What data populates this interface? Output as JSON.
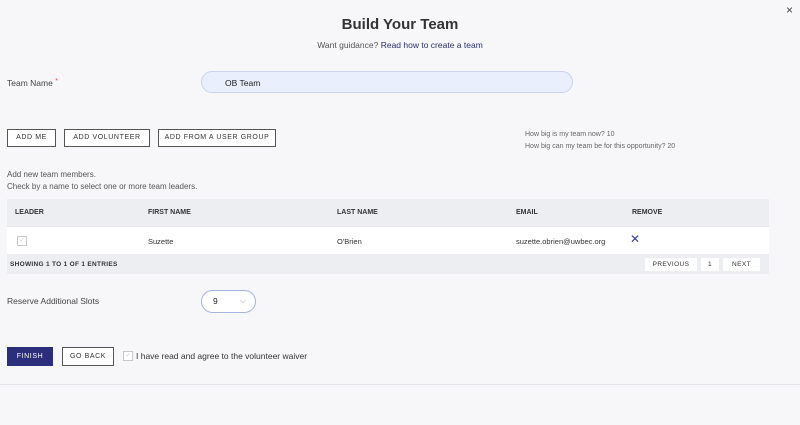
{
  "dialog": {
    "close_glyph": "×",
    "title": "Build Your Team",
    "guidance_prefix": "Want guidance?",
    "guidance_link": "Read how to create a team"
  },
  "team": {
    "label": "Team Name",
    "required_mark": "*",
    "value": "OB Team"
  },
  "actions": {
    "add_me": "ADD ME",
    "add_volunteer": "ADD VOLUNTEER",
    "add_from_group": "ADD FROM A USER GROUP"
  },
  "team_info": {
    "size_now": "How big is my team now? 10",
    "size_max": "How big can my team be for this opportunity? 20"
  },
  "hints": {
    "line1": "Add new team members.",
    "line2": "Check by a name to select one or more team leaders."
  },
  "table": {
    "headers": {
      "leader": "LEADER",
      "first_name": "FIRST NAME",
      "last_name": "LAST NAME",
      "email": "EMAIL",
      "remove": "REMOVE"
    },
    "rows": [
      {
        "leader_glyph": "✓",
        "first_name": "Suzette",
        "last_name": "O'Brien",
        "email": "suzette.obrien@uwbec.org",
        "remove_glyph": "✕"
      }
    ],
    "footer": {
      "showing": "SHOWING 1 TO 1 OF 1 ENTRIES",
      "previous": "PREVIOUS",
      "page": "1",
      "next": "NEXT"
    }
  },
  "reserve": {
    "label": "Reserve Additional Slots",
    "value": "9",
    "chevron": "⌵"
  },
  "footer": {
    "finish": "FINISH",
    "go_back": "GO BACK",
    "waiver_glyph": "✓",
    "waiver_text": "I have read and agree to the volunteer waiver"
  },
  "colors": {
    "primary": "#2b2e7a",
    "input_bg": "#e9effc",
    "required": "#e0463f"
  }
}
